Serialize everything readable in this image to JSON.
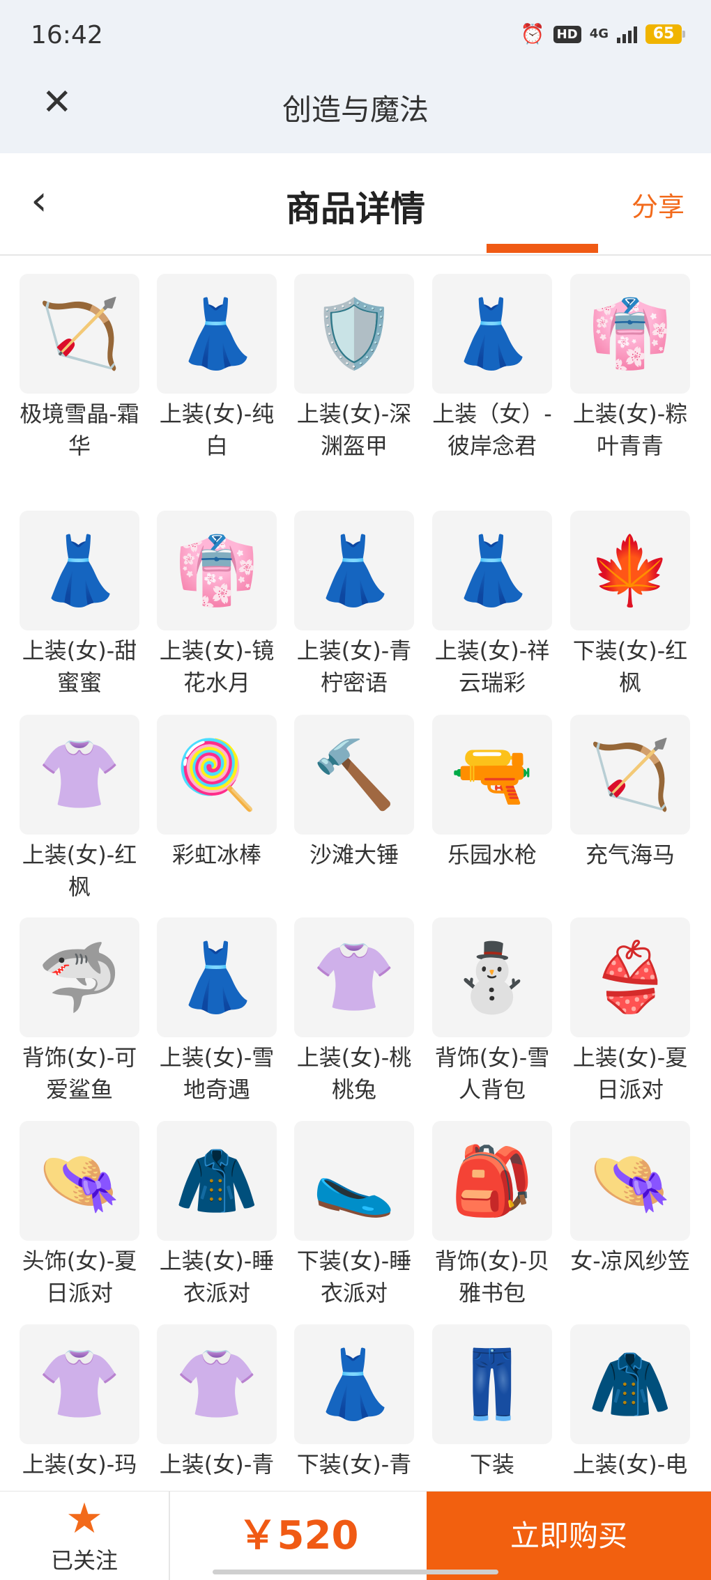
{
  "status_bar": {
    "time": "16:42",
    "network": "4G",
    "battery": "65"
  },
  "app_bar": {
    "title": "创造与魔法"
  },
  "page_header": {
    "title": "商品详情",
    "share": "分享"
  },
  "items": [
    {
      "label": "极境雪晶-霜华",
      "icon": "bow-icon",
      "glyph": "🏹"
    },
    {
      "label": "上装(女)-纯白",
      "icon": "dress-icon",
      "glyph": "👗"
    },
    {
      "label": "上装(女)-深渊盔甲",
      "icon": "armor-icon",
      "glyph": "🛡️"
    },
    {
      "label": "上装（女）-彼岸念君",
      "icon": "dress-icon",
      "glyph": "👗"
    },
    {
      "label": "上装(女)-粽叶青青",
      "icon": "outfit-icon",
      "glyph": "👘"
    },
    {
      "label": "上装(女)-甜蜜蜜",
      "icon": "dress-icon",
      "glyph": "👗"
    },
    {
      "label": "上装(女)-镜花水月",
      "icon": "kimono-icon",
      "glyph": "👘"
    },
    {
      "label": "上装(女)-青柠密语",
      "icon": "dress-icon",
      "glyph": "👗"
    },
    {
      "label": "上装(女)-祥云瑞彩",
      "icon": "dress-icon",
      "glyph": "👗"
    },
    {
      "label": "下装(女)-红枫",
      "icon": "skirt-icon",
      "glyph": "🍁"
    },
    {
      "label": "上装(女)-红枫",
      "icon": "outfit-icon",
      "glyph": "👚"
    },
    {
      "label": "彩虹冰棒",
      "icon": "popsicle-icon",
      "glyph": "🍭"
    },
    {
      "label": "沙滩大锤",
      "icon": "hammer-icon",
      "glyph": "🔨"
    },
    {
      "label": "乐园水枪",
      "icon": "water-gun-icon",
      "glyph": "🔫"
    },
    {
      "label": "充气海马",
      "icon": "inflatable-bow-icon",
      "glyph": "🏹"
    },
    {
      "label": "背饰(女)-可爱鲨鱼",
      "icon": "shark-icon",
      "glyph": "🦈"
    },
    {
      "label": "上装(女)-雪地奇遇",
      "icon": "dress-icon",
      "glyph": "👗"
    },
    {
      "label": "上装(女)-桃桃兔",
      "icon": "outfit-icon",
      "glyph": "👚"
    },
    {
      "label": "背饰(女)-雪人背包",
      "icon": "snowman-icon",
      "glyph": "⛄"
    },
    {
      "label": "上装(女)-夏日派对",
      "icon": "bikini-icon",
      "glyph": "👙"
    },
    {
      "label": "头饰(女)-夏日派对",
      "icon": "hat-icon",
      "glyph": "👒"
    },
    {
      "label": "上装(女)-睡衣派对",
      "icon": "coat-icon",
      "glyph": "🧥"
    },
    {
      "label": "下装(女)-睡衣派对",
      "icon": "slippers-icon",
      "glyph": "🥿"
    },
    {
      "label": "背饰(女)-贝雅书包",
      "icon": "backpack-icon",
      "glyph": "🎒"
    },
    {
      "label": "女-凉风纱笠",
      "icon": "veil-hat-icon",
      "glyph": "👒"
    },
    {
      "label": "上装(女)-玛",
      "icon": "outfit-icon",
      "glyph": "👚"
    },
    {
      "label": "上装(女)-青",
      "icon": "outfit-icon",
      "glyph": "👚"
    },
    {
      "label": "下装(女)-青",
      "icon": "skirt-icon",
      "glyph": "👗"
    },
    {
      "label": "下装",
      "icon": "pants-icon",
      "glyph": "👖"
    },
    {
      "label": "上装(女)-电",
      "icon": "jacket-icon",
      "glyph": "🧥"
    }
  ],
  "bottom_bar": {
    "follow_label": "已关注",
    "price": "￥520",
    "buy_label": "立即购买"
  }
}
